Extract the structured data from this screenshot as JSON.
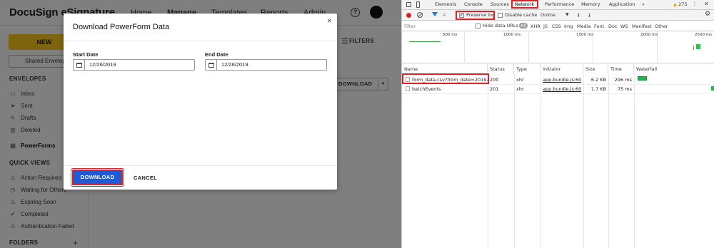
{
  "app": {
    "brand": "DocuSign eSignature",
    "nav": [
      "Home",
      "Manage",
      "Templates",
      "Reports",
      "Admin"
    ],
    "help_icon": "question-circle-icon",
    "new_button": "NEW",
    "shared_envelopes": "Shared Envelopes",
    "sections": {
      "envelopes": "ENVELOPES",
      "quick_views": "QUICK VIEWS",
      "folders": "FOLDERS"
    },
    "envelopes_items": [
      {
        "label": "Inbox",
        "icon": "inbox-icon"
      },
      {
        "label": "Sent",
        "icon": "send-icon"
      },
      {
        "label": "Drafts",
        "icon": "draft-icon"
      },
      {
        "label": "Deleted",
        "icon": "trash-icon"
      }
    ],
    "powerforms": "PowerForms",
    "quick_views_items": [
      {
        "label": "Action Required",
        "icon": "warning-icon"
      },
      {
        "label": "Waiting for Others",
        "icon": "clock-icon"
      },
      {
        "label": "Expiring Soon",
        "icon": "alert-icon"
      },
      {
        "label": "Completed",
        "icon": "check-circle-icon"
      },
      {
        "label": "Authentication Failed",
        "icon": "warning-icon"
      }
    ],
    "filters": "FILTERS",
    "download": "DOWNLOAD"
  },
  "modal": {
    "title": "Download PowerForm Data",
    "close": "×",
    "start_label": "Start Date",
    "start_value": "12/26/2019",
    "end_label": "End Date",
    "end_value": "12/26/2019",
    "download_button": "DOWNLOAD",
    "cancel_button": "CANCEL"
  },
  "devtools": {
    "tabs": [
      "Elements",
      "Console",
      "Sources",
      "Network",
      "Performance",
      "Memory",
      "Application"
    ],
    "active_tab": "Network",
    "more_tabs": "»",
    "warnings": "275",
    "warn_icon": "▲",
    "toolbar": {
      "preserve_log": "Preserve log",
      "disable_cache": "Disable cache",
      "throttle": "Online"
    },
    "filter_placeholder": "Filter",
    "hide_data_urls": "Hide data URLs",
    "type_filters": [
      "All",
      "XHR",
      "JS",
      "CSS",
      "Img",
      "Media",
      "Font",
      "Doc",
      "WS",
      "Manifest",
      "Other"
    ],
    "overview_ticks": [
      "500 ms",
      "1000 ms",
      "1500 ms",
      "2000 ms",
      "2500 ms"
    ],
    "columns": [
      "Name",
      "Status",
      "Type",
      "Initiator",
      "Size",
      "Time",
      "Waterfall"
    ],
    "rows": [
      {
        "name": "form_data.csv?from_date=2019-...",
        "status": "200",
        "type": "xhr",
        "initiator": "app.bundle.js:60",
        "size": "6.2 KB",
        "time": "296 ms"
      },
      {
        "name": "batchEvents",
        "status": "201",
        "type": "xhr",
        "initiator": "app.bundle.js:60",
        "size": "1.7 KB",
        "time": "75 ms"
      }
    ],
    "colors": {
      "highlight": "#d8232a",
      "waterfall": "#1cb84f",
      "accent": "#1a73e8"
    }
  }
}
